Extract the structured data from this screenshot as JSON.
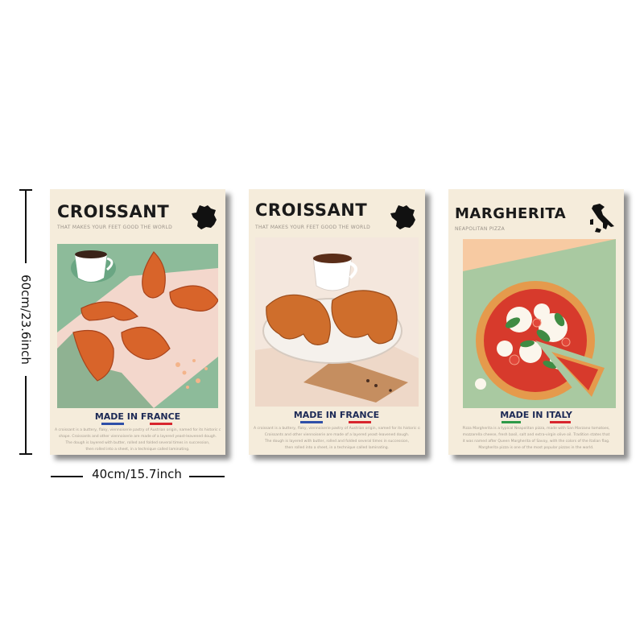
{
  "dimensions": {
    "height_label": "60cm/23.6inch",
    "width_label": "40cm/15.7inch"
  },
  "posters": [
    {
      "title": "CROISSANT",
      "subtitle": "THAT MAKES YOUR FEET GOOD THE WORLD",
      "made_label": "MADE IN FRANCE",
      "country_icon": "france-map-icon",
      "flag_colors": [
        "#2f4fa8",
        "#d8262e"
      ],
      "fine_print": [
        "A croissant is a buttery, flaky, viennoiserie pastry of Austrian origin, named for its historic crescent",
        "shape. Croissants and other viennoiserie are made of a layered yeast-leavened dough.",
        "The dough is layered with butter, rolled and folded several times in succession,",
        "then rolled into a sheet, in a technique called laminating."
      ]
    },
    {
      "title": "CROISSANT",
      "subtitle": "THAT MAKES YOUR FEET GOOD THE WORLD",
      "made_label": "MADE IN FRANCE",
      "country_icon": "france-map-icon",
      "flag_colors": [
        "#2f4fa8",
        "#d8262e"
      ],
      "fine_print": [
        "A croissant is a buttery, flaky, viennoiserie pastry of Austrian origin, named for its historic crescent shape.",
        "Croissants and other viennoiserie are made of a layered yeast-leavened dough.",
        "The dough is layered with butter, rolled and folded several times in succession,",
        "then rolled into a sheet, in a technique called laminating."
      ]
    },
    {
      "title": "MARGHERITA",
      "subtitle": "NEAPOLITAN PIZZA",
      "made_label": "MADE IN ITALY",
      "country_icon": "italy-map-icon",
      "flag_colors": [
        "#2e9a48",
        "#d8262e"
      ],
      "fine_print": [
        "Pizza Margherita is a typical Neapolitan pizza, made with San Marzano tomatoes,",
        "mozzarella cheese, fresh basil, salt and extra-virgin olive oil. Tradition states that",
        "it was named after Queen Margherita of Savoy, with the colors of the Italian flag.",
        "Margherita pizza is one of the most popular pizzas in the world."
      ]
    }
  ]
}
